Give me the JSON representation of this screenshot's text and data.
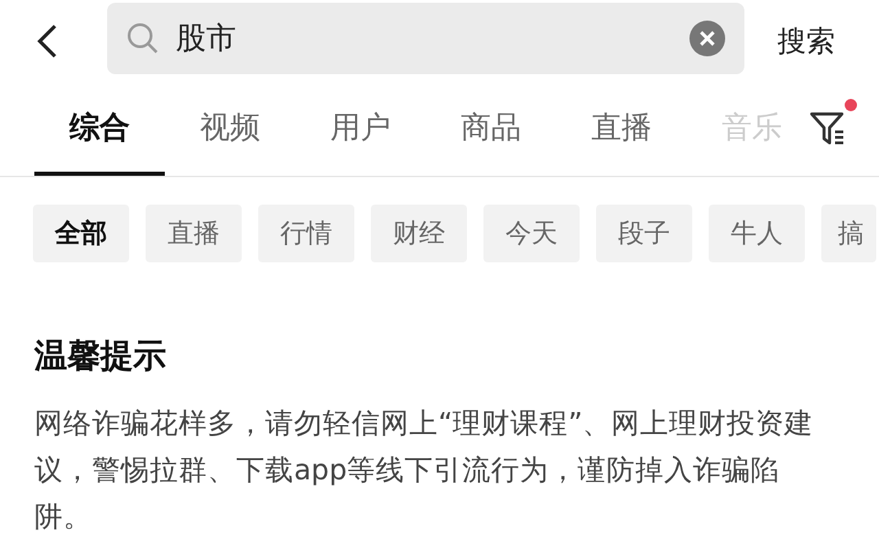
{
  "search": {
    "value": "股市",
    "action": "搜索"
  },
  "tabs": [
    {
      "label": "综合",
      "selected": true
    },
    {
      "label": "视频",
      "selected": false
    },
    {
      "label": "用户",
      "selected": false
    },
    {
      "label": "商品",
      "selected": false
    },
    {
      "label": "直播",
      "selected": false
    },
    {
      "label": "音乐",
      "selected": false
    }
  ],
  "filter": {
    "has_dot": true
  },
  "chips": [
    {
      "label": "全部",
      "selected": true
    },
    {
      "label": "直播",
      "selected": false
    },
    {
      "label": "行情",
      "selected": false
    },
    {
      "label": "财经",
      "selected": false
    },
    {
      "label": "今天",
      "selected": false
    },
    {
      "label": "段子",
      "selected": false
    },
    {
      "label": "牛人",
      "selected": false
    },
    {
      "label": "搞",
      "selected": false
    }
  ],
  "notice": {
    "title": "温馨提示",
    "text": "网络诈骗花样多，请勿轻信网上“理财课程”、网上理财投资建议，警惕拉群、下载app等线下引流行为，谨防掉入诈骗陷阱。"
  }
}
